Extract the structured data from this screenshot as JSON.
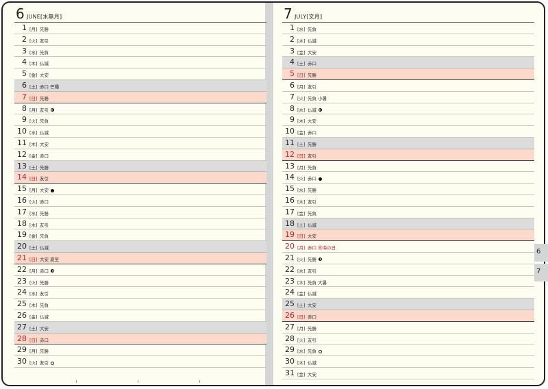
{
  "left": {
    "month_number": "6",
    "month_name": "JUNE[水無月]",
    "days": [
      {
        "d": "1",
        "w": "[月]",
        "r": "先勝",
        "t": ""
      },
      {
        "d": "2",
        "w": "[火]",
        "r": "友引",
        "t": ""
      },
      {
        "d": "3",
        "w": "[水]",
        "r": "先負",
        "t": ""
      },
      {
        "d": "4",
        "w": "[木]",
        "r": "仏滅",
        "t": ""
      },
      {
        "d": "5",
        "w": "[金]",
        "r": "大安",
        "t": ""
      },
      {
        "d": "6",
        "w": "[土]",
        "r": "赤口 芒種",
        "t": "sat"
      },
      {
        "d": "7",
        "w": "[日]",
        "r": "先勝",
        "t": "sun"
      },
      {
        "d": "8",
        "w": "[月]",
        "r": "友引",
        "t": "",
        "moon": "first"
      },
      {
        "d": "9",
        "w": "[火]",
        "r": "先負",
        "t": ""
      },
      {
        "d": "10",
        "w": "[水]",
        "r": "仏滅",
        "t": ""
      },
      {
        "d": "11",
        "w": "[木]",
        "r": "大安",
        "t": ""
      },
      {
        "d": "12",
        "w": "[金]",
        "r": "赤口",
        "t": ""
      },
      {
        "d": "13",
        "w": "[土]",
        "r": "先勝",
        "t": "sat"
      },
      {
        "d": "14",
        "w": "[日]",
        "r": "友引",
        "t": "sun"
      },
      {
        "d": "15",
        "w": "[月]",
        "r": "大安",
        "t": "",
        "moon": "new"
      },
      {
        "d": "16",
        "w": "[火]",
        "r": "赤口",
        "t": ""
      },
      {
        "d": "17",
        "w": "[水]",
        "r": "先勝",
        "t": ""
      },
      {
        "d": "18",
        "w": "[木]",
        "r": "友引",
        "t": ""
      },
      {
        "d": "19",
        "w": "[金]",
        "r": "先負",
        "t": ""
      },
      {
        "d": "20",
        "w": "[土]",
        "r": "仏滅",
        "t": "sat"
      },
      {
        "d": "21",
        "w": "[日]",
        "r": "大安 夏至",
        "t": "sun"
      },
      {
        "d": "22",
        "w": "[月]",
        "r": "赤口",
        "t": "",
        "moon": "last"
      },
      {
        "d": "23",
        "w": "[火]",
        "r": "先勝",
        "t": ""
      },
      {
        "d": "24",
        "w": "[水]",
        "r": "友引",
        "t": ""
      },
      {
        "d": "25",
        "w": "[木]",
        "r": "先負",
        "t": ""
      },
      {
        "d": "26",
        "w": "[金]",
        "r": "仏滅",
        "t": ""
      },
      {
        "d": "27",
        "w": "[土]",
        "r": "大安",
        "t": "sat"
      },
      {
        "d": "28",
        "w": "[日]",
        "r": "赤口",
        "t": "sun"
      },
      {
        "d": "29",
        "w": "[月]",
        "r": "先勝",
        "t": ""
      },
      {
        "d": "30",
        "w": "[火]",
        "r": "友引",
        "t": "",
        "moon": "full"
      }
    ]
  },
  "right": {
    "month_number": "7",
    "month_name": "JULY[文月]",
    "days": [
      {
        "d": "1",
        "w": "[水]",
        "r": "先負",
        "t": ""
      },
      {
        "d": "2",
        "w": "[木]",
        "r": "仏滅",
        "t": ""
      },
      {
        "d": "3",
        "w": "[金]",
        "r": "大安",
        "t": ""
      },
      {
        "d": "4",
        "w": "[土]",
        "r": "赤口",
        "t": "sat"
      },
      {
        "d": "5",
        "w": "[日]",
        "r": "先勝",
        "t": "sun"
      },
      {
        "d": "6",
        "w": "[月]",
        "r": "友引",
        "t": ""
      },
      {
        "d": "7",
        "w": "[火]",
        "r": "先負 小暑",
        "t": ""
      },
      {
        "d": "8",
        "w": "[水]",
        "r": "仏滅",
        "t": "",
        "moon": "first"
      },
      {
        "d": "9",
        "w": "[木]",
        "r": "大安",
        "t": ""
      },
      {
        "d": "10",
        "w": "[金]",
        "r": "赤口",
        "t": ""
      },
      {
        "d": "11",
        "w": "[土]",
        "r": "先勝",
        "t": "sat"
      },
      {
        "d": "12",
        "w": "[日]",
        "r": "友引",
        "t": "sun"
      },
      {
        "d": "13",
        "w": "[月]",
        "r": "先負",
        "t": ""
      },
      {
        "d": "14",
        "w": "[火]",
        "r": "赤口",
        "t": "",
        "moon": "new"
      },
      {
        "d": "15",
        "w": "[水]",
        "r": "先勝",
        "t": ""
      },
      {
        "d": "16",
        "w": "[木]",
        "r": "友引",
        "t": ""
      },
      {
        "d": "17",
        "w": "[金]",
        "r": "先負",
        "t": ""
      },
      {
        "d": "18",
        "w": "[土]",
        "r": "仏滅",
        "t": "sat"
      },
      {
        "d": "19",
        "w": "[日]",
        "r": "大安",
        "t": "sun"
      },
      {
        "d": "20",
        "w": "[月]",
        "r": "赤口 ㊗海の日",
        "t": "hol"
      },
      {
        "d": "21",
        "w": "[火]",
        "r": "先勝",
        "t": "",
        "moon": "last"
      },
      {
        "d": "22",
        "w": "[水]",
        "r": "友引",
        "t": ""
      },
      {
        "d": "23",
        "w": "[木]",
        "r": "先負 大暑",
        "t": ""
      },
      {
        "d": "24",
        "w": "[金]",
        "r": "仏滅",
        "t": ""
      },
      {
        "d": "25",
        "w": "[土]",
        "r": "大安",
        "t": "sat"
      },
      {
        "d": "26",
        "w": "[日]",
        "r": "赤口",
        "t": "sun"
      },
      {
        "d": "27",
        "w": "[月]",
        "r": "先勝",
        "t": ""
      },
      {
        "d": "28",
        "w": "[火]",
        "r": "友引",
        "t": ""
      },
      {
        "d": "29",
        "w": "[水]",
        "r": "先負",
        "t": "",
        "moon": "full"
      },
      {
        "d": "30",
        "w": "[木]",
        "r": "仏滅",
        "t": ""
      },
      {
        "d": "31",
        "w": "[金]",
        "r": "大安",
        "t": ""
      }
    ]
  },
  "tabs": [
    "6",
    "7"
  ],
  "colors": {
    "paper": "#fefdf2",
    "saturday": "#dcdcdc",
    "sunday": "#fbd9cb",
    "sunday_text": "#c8202a",
    "gutter": "#d4d6d6"
  }
}
